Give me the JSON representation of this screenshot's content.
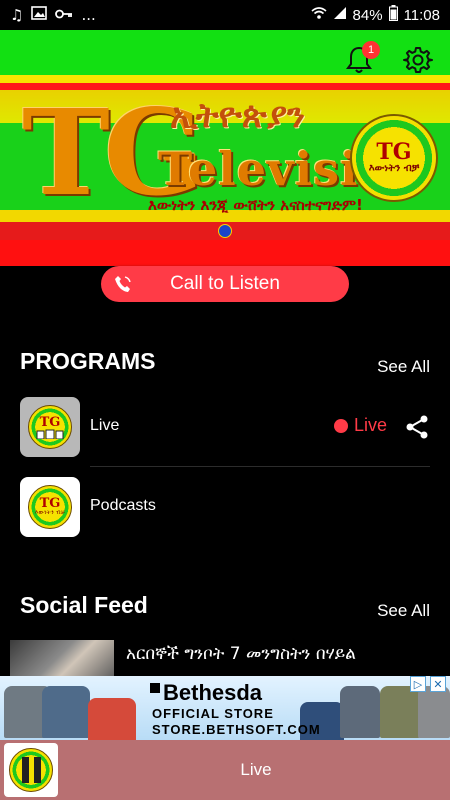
{
  "status_bar": {
    "battery": "84%",
    "time": "11:08",
    "more": "...",
    "left_icons": [
      "music-note-icon",
      "image-icon",
      "key-icon"
    ],
    "right_icons": [
      "wifi-icon",
      "signal-icon",
      "battery-icon"
    ]
  },
  "header": {
    "notification_count": "1",
    "icons": [
      "bell-icon",
      "gear-icon"
    ],
    "colors": {
      "green": "#12e012",
      "yellow": "#f7e600",
      "red": "#ff1a1a"
    }
  },
  "banner": {
    "letters": "TG",
    "amharic_title": "ኢትዮጵያን",
    "title": "Television",
    "slogan": "እውነትን እንጂ ውሸትን አናስተናግድም!",
    "logo_letters": "TG",
    "logo_text": "እውነትን ብቻ"
  },
  "call_button": {
    "label": "Call to Listen",
    "color": "#ff3b47"
  },
  "programs": {
    "title": "PROGRAMS",
    "see_all": "See All",
    "items": [
      {
        "label": "Live",
        "live_label": "Live",
        "thumb_letters": "TG"
      },
      {
        "label": "Podcasts",
        "thumb_letters": "TG",
        "thumb_text": "እውነትን ብቻ"
      }
    ]
  },
  "social_feed": {
    "title": "Social Feed",
    "see_all": "See All",
    "items": [
      {
        "headline": "አርበኞች ግንቦት 7 መንግስትን በሃይል"
      }
    ]
  },
  "ad": {
    "brand": "Bethesda",
    "subtitle": "OFFICIAL STORE",
    "url": "STORE.BETHSOFT.COM",
    "shirt_colors": [
      "#6f7a83",
      "#4f6b8a",
      "#d54a3a",
      "#2f4e7a",
      "#5d6a7a",
      "#7a7f5a",
      "#8a8c8f"
    ]
  },
  "player": {
    "title": "Live",
    "color": "#b87072"
  }
}
